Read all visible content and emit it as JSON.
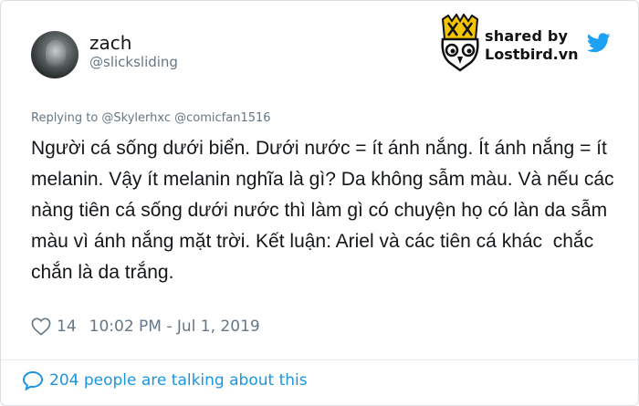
{
  "user": {
    "name": "zach",
    "handle": "@slicksliding"
  },
  "brand": {
    "shared_label": "shared by",
    "site": "Lostbird.vn",
    "logo_icon": "owl-logo-icon",
    "bird_icon": "twitter-bird-icon",
    "accent_color": "#1da1f2",
    "logo_color": "#f5c400"
  },
  "tweet": {
    "replying_to": "Replying to @Skylerhxc @comicfan1516",
    "text": "Người cá sống dưới biển. Dưới nước = ít ánh nắng. Ít ánh nắng = ít melanin. Vậy ít melanin nghĩa là gì? Da không sẫm màu. Và nếu các nàng tiên cá sống dưới nước thì làm gì có chuyện họ có làn da sẫm màu vì ánh nắng mặt trời. Kết luận: Ariel và các tiên cá khác  chắc chắn là da trắng.",
    "likes": "14",
    "timestamp": "10:02 PM - Jul 1, 2019",
    "like_icon": "heart-icon"
  },
  "footer": {
    "talking_text": "204 people are talking about this",
    "icon": "comment-bubble-icon",
    "link_color": "#1b95e0"
  }
}
